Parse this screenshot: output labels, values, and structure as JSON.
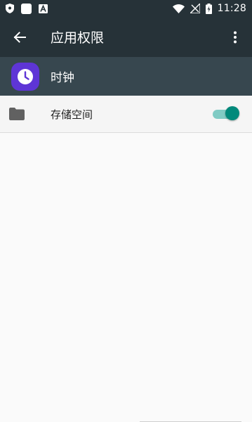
{
  "status_bar": {
    "time": "11:28",
    "icons": [
      "shield-icon",
      "square-icon",
      "a-icon",
      "wifi-icon",
      "no-signal-icon",
      "battery-charging-icon"
    ]
  },
  "app_bar": {
    "title": "应用权限",
    "back_icon": "arrow-back-icon",
    "overflow_icon": "more-vert-icon"
  },
  "app_header": {
    "name": "时钟",
    "icon": "clock-icon",
    "icon_bg": "#5e35d6"
  },
  "permissions": [
    {
      "label": "存储空间",
      "icon": "folder-icon",
      "enabled": true
    }
  ],
  "colors": {
    "status_bar_bg": "#263238",
    "app_bar_bg": "#263238",
    "app_header_bg": "#37474f",
    "toggle_on": "#00897b",
    "toggle_track": "#80cbc4"
  }
}
